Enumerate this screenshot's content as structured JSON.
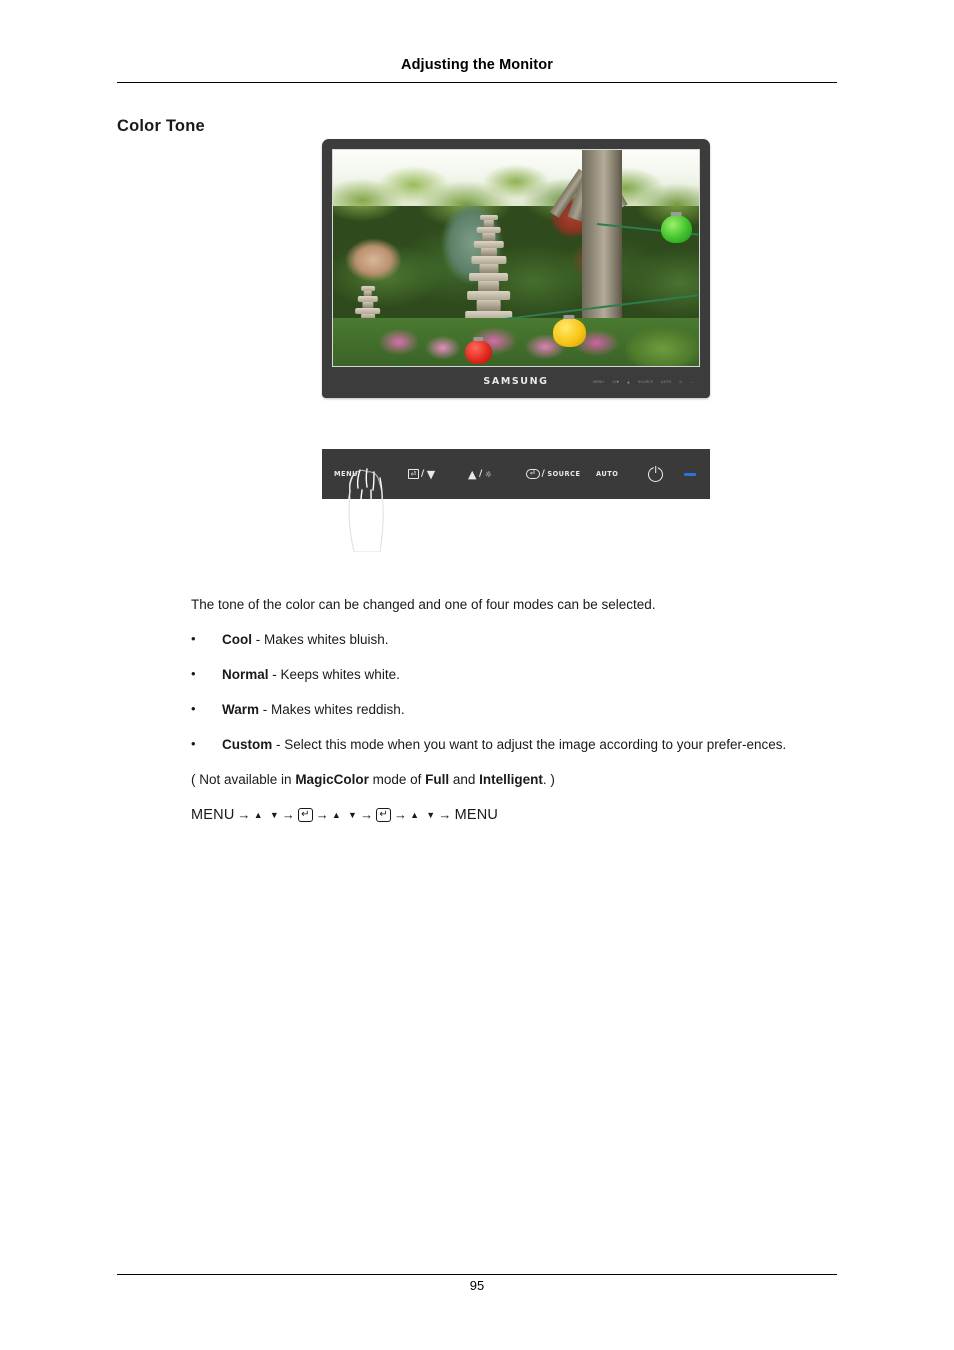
{
  "header": {
    "title": "Adjusting the Monitor"
  },
  "section": {
    "title": "Color Tone"
  },
  "figure": {
    "monitor_brand": "SAMSUNG",
    "screen_description": "Photograph of a Korean garden with a multi-tier stone pagoda, a large tree trunk, green and red foliage, pink flower beds and red, yellow and green paper lanterns",
    "chin_controls": [
      "MENU",
      "AUTO",
      "☀",
      "SOURCE",
      "AUTO",
      "⏻",
      "—"
    ],
    "control_panel": {
      "buttons": [
        {
          "name": "menu-button",
          "label": "MENU",
          "secondary": ""
        },
        {
          "name": "enter-down-button",
          "label": "",
          "icon": "enter-box-icon",
          "separator": "/",
          "arrow": "▼"
        },
        {
          "name": "up-brightness-button",
          "label": "",
          "arrow": "▲",
          "separator": "/",
          "icon": "brightness-sun-icon"
        },
        {
          "name": "source-button",
          "label": "SOURCE",
          "icon": "source-pill-icon",
          "separator": "/"
        },
        {
          "name": "auto-button",
          "label": "AUTO"
        },
        {
          "name": "power-button",
          "label": "",
          "icon": "power-icon"
        },
        {
          "name": "power-led",
          "label": "",
          "icon": "led-indicator",
          "color": "#2f6fe0"
        }
      ],
      "background_color": "#3a3a3a"
    },
    "pointer": "hand-pointing-at-menu-button"
  },
  "content": {
    "intro": "The tone of the color can be changed and one of four modes can be selected.",
    "modes": [
      {
        "name": "Cool",
        "description": " - Makes whites bluish."
      },
      {
        "name": "Normal",
        "description": " - Keeps whites white."
      },
      {
        "name": "Warm",
        "description": " - Makes whites reddish."
      },
      {
        "name": "Custom",
        "description": " - Select this mode when you want to adjust the image according to your prefer-ences."
      }
    ],
    "note_prefix": "( Not available in ",
    "note_term1": "MagicColor",
    "note_mid": " mode of ",
    "note_term2": "Full",
    "note_and": " and ",
    "note_term3": "Intelligent",
    "note_suffix": ". )",
    "nav": {
      "start": "MENU",
      "arrow": "→",
      "up": "▲",
      "down": "▼",
      "enter": "↵",
      "end": "MENU"
    }
  },
  "footer": {
    "page_number": "95"
  }
}
